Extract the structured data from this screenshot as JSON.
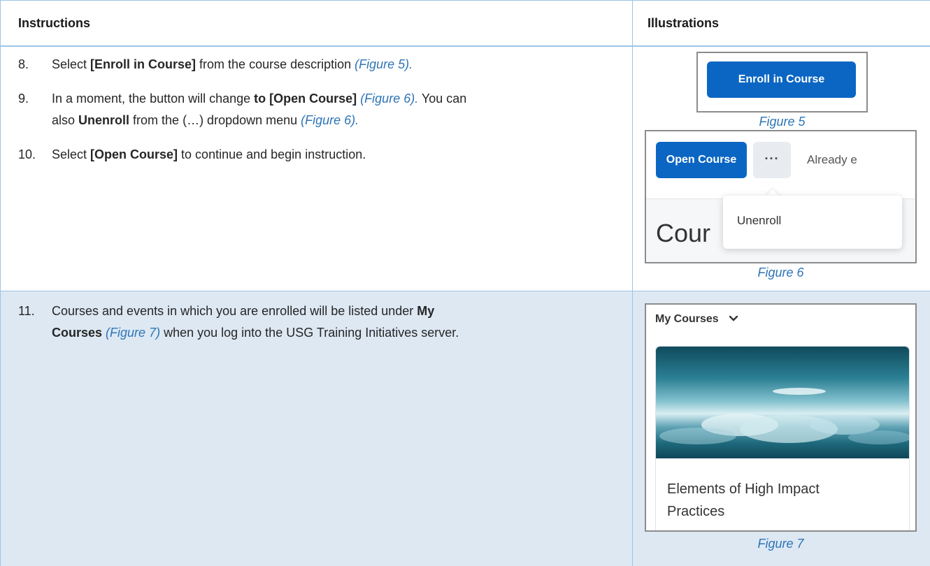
{
  "header": {
    "instructions": "Instructions",
    "illustrations": "Illustrations"
  },
  "steps": [
    {
      "num": "8.",
      "lines": [
        {
          "pre": "Select ",
          "bold": "[Enroll in Course]",
          "mid": " from the course description ",
          "ref": "(Figure 5).",
          "post": ""
        }
      ]
    },
    {
      "num": "9.",
      "lines": [
        {
          "pre": "In a moment, the button will change ",
          "bold": "to [Open Course]",
          "mid": " ",
          "ref": "(Figure 6).",
          "post": " You can"
        },
        {
          "pre": "also ",
          "bold": "Unenroll",
          "mid": " from the (…) dropdown menu ",
          "ref": "(Figure 6).",
          "post": ""
        }
      ]
    },
    {
      "num": "10.",
      "lines": [
        {
          "pre": "Select ",
          "bold": "[Open Course]",
          "mid": " to continue and begin instruction.",
          "ref": "",
          "post": ""
        }
      ]
    },
    {
      "num": "11.",
      "lines": [
        {
          "pre": "Courses and events in which you are enrolled will be listed under ",
          "bold": "My",
          "mid": "",
          "ref": "",
          "post": ""
        },
        {
          "pre": "",
          "bold": "Courses",
          "mid": " ",
          "ref": "(Figure 7)",
          "post": " when you log into the USG Training Initiatives server."
        }
      ]
    }
  ],
  "figure5": {
    "button": "Enroll in Course",
    "caption": "Figure 5"
  },
  "figure6": {
    "open_button": "Open Course",
    "more_button": "···",
    "status_text": "Already e",
    "menu_item": "Unenroll",
    "heading_partial": "Cour",
    "caption": "Figure 6"
  },
  "figure7": {
    "header": "My Courses",
    "course_title_line1": "Elements of High Impact",
    "course_title_line2": "Practices",
    "caption": "Figure 7"
  },
  "colors": {
    "border": "#9dc3e6",
    "band": "#dde8f3",
    "accent": "#2e75b6",
    "button": "#0b66c3"
  }
}
